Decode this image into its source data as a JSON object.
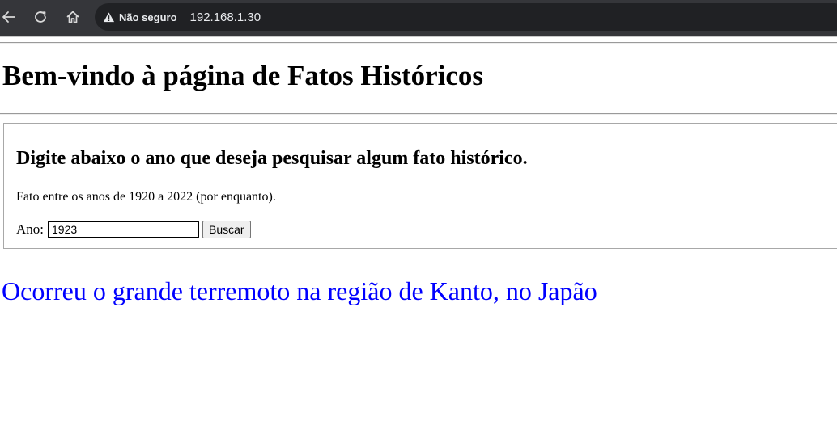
{
  "browser": {
    "security_label": "Não seguro",
    "url": "192.168.1.30",
    "icons": {
      "back": "back-arrow-icon",
      "reload": "reload-icon",
      "home": "home-icon",
      "security": "warning-triangle-icon"
    }
  },
  "page": {
    "title": "Bem-vindo à página de Fatos Históricos",
    "form": {
      "heading": "Digite abaixo o ano que deseja pesquisar algum fato histórico.",
      "note": "Fato entre os anos de 1920 a 2022 (por enquanto).",
      "year_label": "Ano:",
      "year_value": "1923",
      "search_button_label": "Buscar"
    },
    "result": "Ocorreu o grande terremoto na região de Kanto, no Japão",
    "colors": {
      "result_text": "#0000ff",
      "chrome_background": "#35363a",
      "omnibox_background": "#202124"
    }
  }
}
